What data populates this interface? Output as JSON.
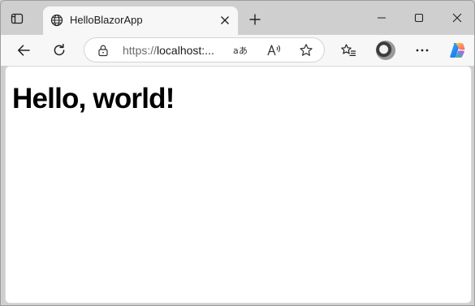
{
  "tab": {
    "title": "HelloBlazorApp"
  },
  "addressbar": {
    "url_scheme": "https://",
    "url_host": "localhost:..."
  },
  "page": {
    "heading": "Hello, world!"
  },
  "icons": {
    "tab_actions": "tab-actions-icon",
    "favicon": "globe-icon",
    "tab_close": "close-icon",
    "new_tab": "plus-icon",
    "minimize": "minimize-icon",
    "maximize": "maximize-icon",
    "close_window": "close-icon",
    "back": "back-arrow-icon",
    "refresh": "refresh-icon",
    "lock": "lock-icon",
    "translate": "translate-icon",
    "read_aloud": "read-aloud-icon",
    "favorite": "star-icon",
    "favorites": "favorites-icon",
    "more": "more-icon",
    "copilot": "copilot-icon"
  },
  "colors": {
    "chrome": "#cfcfcf",
    "toolbar": "#f7f7f7",
    "page_bg": "#ffffff"
  }
}
